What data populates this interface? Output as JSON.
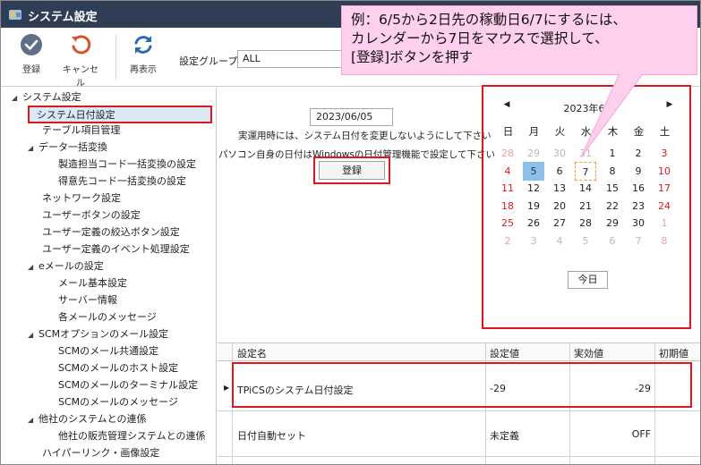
{
  "window": {
    "title": "システム設定"
  },
  "toolbar": {
    "register_label": "登録",
    "cancel_label": "キャンセル",
    "refresh_label": "再表示",
    "group_label": "設定グループ",
    "group_value": "ALL"
  },
  "sidebar": {
    "items": [
      {
        "label": "システム設定"
      },
      {
        "label": "システム日付設定"
      },
      {
        "label": "テーブル項目管理"
      },
      {
        "label": "データ一括変換"
      },
      {
        "label": "製造担当コード一括変換の設定"
      },
      {
        "label": "得意先コード一括変換の設定"
      },
      {
        "label": "ネットワーク設定"
      },
      {
        "label": "ユーザーボタンの設定"
      },
      {
        "label": "ユーザー定義の絞込ボタン設定"
      },
      {
        "label": "ユーザー定義のイベント処理設定"
      },
      {
        "label": "eメールの設定"
      },
      {
        "label": "メール基本設定"
      },
      {
        "label": "サーバー情報"
      },
      {
        "label": "各メールのメッセージ"
      },
      {
        "label": "SCMオプションのメール設定"
      },
      {
        "label": "SCMのメール共通設定"
      },
      {
        "label": "SCMのメールのホスト設定"
      },
      {
        "label": "SCMのメールのターミナル設定"
      },
      {
        "label": "SCMのメールのメッセージ"
      },
      {
        "label": "他社のシステムとの連係"
      },
      {
        "label": "他社の販売管理システムとの連係"
      },
      {
        "label": "ハイパーリンク・画像設定"
      }
    ]
  },
  "main": {
    "date_value": "2023/06/05",
    "note_1": "実運用時には、システム日付を変更しないようにして下さい",
    "note_2": "パソコン自身の日付はWindowsの日付管理機能で設定して下さい",
    "register_button": "登録"
  },
  "calendar": {
    "month_label": "2023年6月",
    "weekdays": [
      "日",
      "月",
      "火",
      "水",
      "木",
      "金",
      "土"
    ],
    "days": [
      [
        "28",
        "29",
        "30",
        "31",
        "1",
        "2",
        "3"
      ],
      [
        "4",
        "5",
        "6",
        "7",
        "8",
        "9",
        "10"
      ],
      [
        "11",
        "12",
        "13",
        "14",
        "15",
        "16",
        "17"
      ],
      [
        "18",
        "19",
        "20",
        "21",
        "22",
        "23",
        "24"
      ],
      [
        "25",
        "26",
        "27",
        "28",
        "29",
        "30",
        "1"
      ],
      [
        "2",
        "3",
        "4",
        "5",
        "6",
        "7",
        "8"
      ]
    ],
    "today_button": "今日"
  },
  "callout": {
    "line_1": "例：6/5から2日先の稼動日6/7にするには、",
    "line_2": "カレンダーから7日をマウスで選択して、",
    "line_3": "[登録]ボタンを押す"
  },
  "grid": {
    "headers": [
      "設定名",
      "設定値",
      "実効値",
      "初期値"
    ],
    "rows": [
      {
        "name": "TPiCSのシステム日付設定",
        "value": "-29",
        "effective": "-29",
        "initial": ""
      },
      {
        "name": "日付自動セット",
        "value": "未定義",
        "effective": "OFF",
        "initial": ""
      }
    ]
  },
  "colors": {
    "titlebar": "#2f3e55",
    "highlight_red": "#e0161d",
    "callout_bg": "#ffd0ee",
    "selection_blue": "#8dbfe8"
  }
}
